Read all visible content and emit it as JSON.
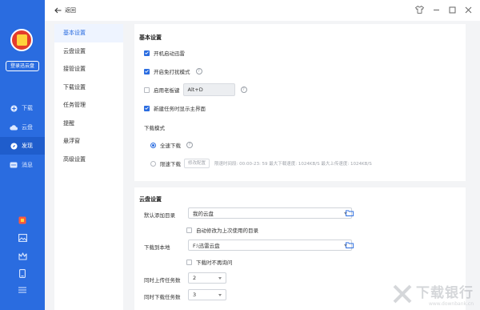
{
  "sidebar": {
    "login_label": "登录迅云盘",
    "items": [
      {
        "label": "下载",
        "icon": "plus-circle-icon"
      },
      {
        "label": "云盘",
        "icon": "cloud-icon"
      },
      {
        "label": "发现",
        "icon": "compass-icon"
      },
      {
        "label": "消息",
        "icon": "message-icon"
      }
    ],
    "bottom_icons": [
      "gift-icon",
      "photo-icon",
      "crown-icon",
      "tablet-icon",
      "menu-icon"
    ],
    "accent": "#2a6ce0"
  },
  "topbar": {
    "back_label": "返回"
  },
  "subnav": {
    "items": [
      "基本设置",
      "云盘设置",
      "接管设置",
      "下载设置",
      "任务管理",
      "提醒",
      "悬浮窗",
      "高级设置"
    ],
    "active_index": 0
  },
  "basic": {
    "title": "基本设置",
    "autostart": "开机启动迅雷",
    "dnd": "开启免打扰模式",
    "boss_key": "启用老板键",
    "boss_key_value": "Alt+D",
    "show_main": "新建任务时显示主界面",
    "download_mode_label": "下载模式",
    "fullspeed": "全速下载",
    "limited": "限速下载",
    "edit_config": "修改配置",
    "limit_info": "限速时间段:  00:00-23: 59   最大下载速度: 1024KB/S    最大上传速度: 1024KB/S"
  },
  "cloud": {
    "title": "云盘设置",
    "default_dir_label": "默认添加目录",
    "default_dir_value": "我的云盘",
    "auto_modify": "自动修改为上次使用的目录",
    "local_dir_label": "下载到本地",
    "local_dir_value": "F:\\迅雷云盘",
    "no_ask": "下载时不再询问",
    "upload_count_label": "同时上传任务数",
    "upload_count_value": "2",
    "download_count_label": "同时下载任务数",
    "download_count_value": "3"
  },
  "watermark": {
    "text": "下载银行",
    "url": "www.downbank.cn"
  }
}
